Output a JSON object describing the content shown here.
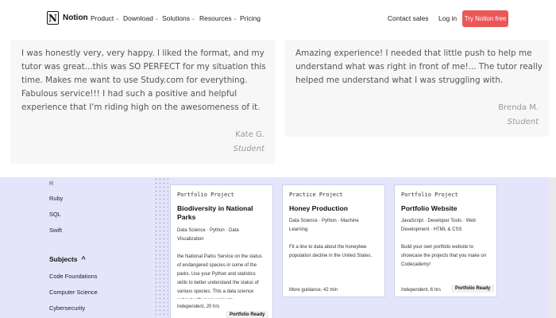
{
  "nav": {
    "brand": "Notion",
    "logo_letter": "N",
    "items": [
      {
        "label": "Product"
      },
      {
        "label": "Download"
      },
      {
        "label": "Solutions"
      },
      {
        "label": "Resources"
      },
      {
        "label": "Pricing"
      }
    ],
    "chevron": "⌄",
    "contact": "Contact sales",
    "login": "Log in",
    "cta": "Try Notion free"
  },
  "testimonials": [
    {
      "quote": "I was honestly very, very happy. I liked the format, and my tutor was great...this was SO PERFECT for my situation this time. Makes me want to use Study.com for everything. Fabulous service!!! I had such a positive and helpful experience that I'm riding high on the awesomeness of it.",
      "name": "Kate G.",
      "role": "Student"
    },
    {
      "quote": "Amazing experience! I needed that little push to help me understand what was right in front of me!... The tutor really helped me understand what I was struggling with.",
      "name": "Brenda M.",
      "role": "Student"
    }
  ],
  "sidebar": {
    "languages": [
      "R",
      "Ruby",
      "SQL",
      "Swift"
    ],
    "subjects_heading": "Subjects",
    "subjects_caret": "^",
    "subjects": [
      "Code Foundations",
      "Computer Science",
      "Cybersecurity"
    ]
  },
  "projects": [
    {
      "type": "Portfolio Project",
      "title": "Biodiversity in National Parks",
      "tags": "Data Science · Python · Data Visualization",
      "desc": "the National Parks Service on the status of endangered species in some of the parks. Use your Python and statistics skills to better understand the status of various species. This a data science subject with many projects",
      "meta": "Independent, 20 hrs",
      "badge": "Portfolio Ready"
    },
    {
      "type": "Practice Project",
      "title": "Honey Production",
      "tags": "Data Science · Python · Machine Learning",
      "desc": "Fit a line to data about the honeybee population decline in the United States.",
      "meta": "More guidance, 42 min",
      "badge": ""
    },
    {
      "type": "Portfolio Project",
      "title": "Portfolio Website",
      "tags": "JavaScript · Developer Tools · Web Development · HTML & CSS",
      "desc": "Build your own portfolio website to showcase the projects that you make on Codecademy!",
      "meta": "Independent, 6 hrs",
      "badge": "Portfolio Ready"
    }
  ],
  "colors": {
    "cta": "#eb5757",
    "catalog_bg": "#e4e4fa",
    "card_bg": "#f7f7f7"
  }
}
